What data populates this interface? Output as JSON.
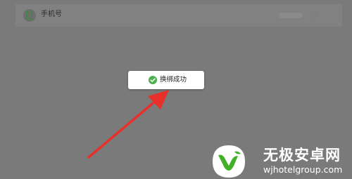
{
  "settings_row": {
    "label": "手机号",
    "icon": "phone-icon"
  },
  "toast": {
    "message": "换绑成功",
    "icon": "check-circle-icon",
    "icon_color": "#4caf50"
  },
  "annotation": {
    "arrow_color": "#e8302a"
  },
  "watermark": {
    "title": "无极安卓网",
    "url": "wjhotelgroup.com",
    "logo_color": "#43b02a"
  }
}
